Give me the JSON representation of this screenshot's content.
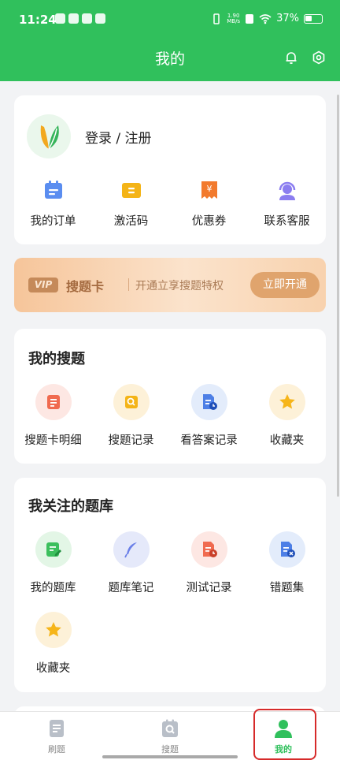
{
  "status_bar": {
    "time": "11:24",
    "net_speed_value": "1.90",
    "net_speed_unit": "MB/s",
    "battery": "37%"
  },
  "header": {
    "title": "我的"
  },
  "profile": {
    "login_label": "登录 / 注册",
    "shortcuts": [
      {
        "label": "我的订单",
        "icon": "order-icon"
      },
      {
        "label": "激活码",
        "icon": "activation-code-icon"
      },
      {
        "label": "优惠券",
        "icon": "coupon-icon"
      },
      {
        "label": "联系客服",
        "icon": "customer-service-icon"
      }
    ]
  },
  "vip_banner": {
    "badge": "VIP",
    "name": "搜题卡",
    "description": "开通立享搜题特权",
    "button": "立即开通"
  },
  "my_search": {
    "title": "我的搜题",
    "items": [
      {
        "label": "搜题卡明细",
        "icon": "card-detail-icon"
      },
      {
        "label": "搜题记录",
        "icon": "search-record-icon"
      },
      {
        "label": "看答案记录",
        "icon": "answer-record-icon"
      },
      {
        "label": "收藏夹",
        "icon": "star-icon"
      }
    ]
  },
  "followed_banks": {
    "title": "我关注的题库",
    "items": [
      {
        "label": "我的题库",
        "icon": "question-bank-icon"
      },
      {
        "label": "题库笔记",
        "icon": "feather-icon"
      },
      {
        "label": "测试记录",
        "icon": "test-record-icon"
      },
      {
        "label": "错题集",
        "icon": "wrong-questions-icon"
      },
      {
        "label": "收藏夹",
        "icon": "star-icon"
      }
    ]
  },
  "bottom_nav": {
    "items": [
      {
        "label": "刷题",
        "icon": "practice-icon"
      },
      {
        "label": "搜题",
        "icon": "search-icon"
      },
      {
        "label": "我的",
        "icon": "user-icon",
        "active": true
      }
    ]
  },
  "colors": {
    "brand": "#30c05c",
    "highlight": "#d62a2a",
    "vip": "#e0a46d"
  }
}
